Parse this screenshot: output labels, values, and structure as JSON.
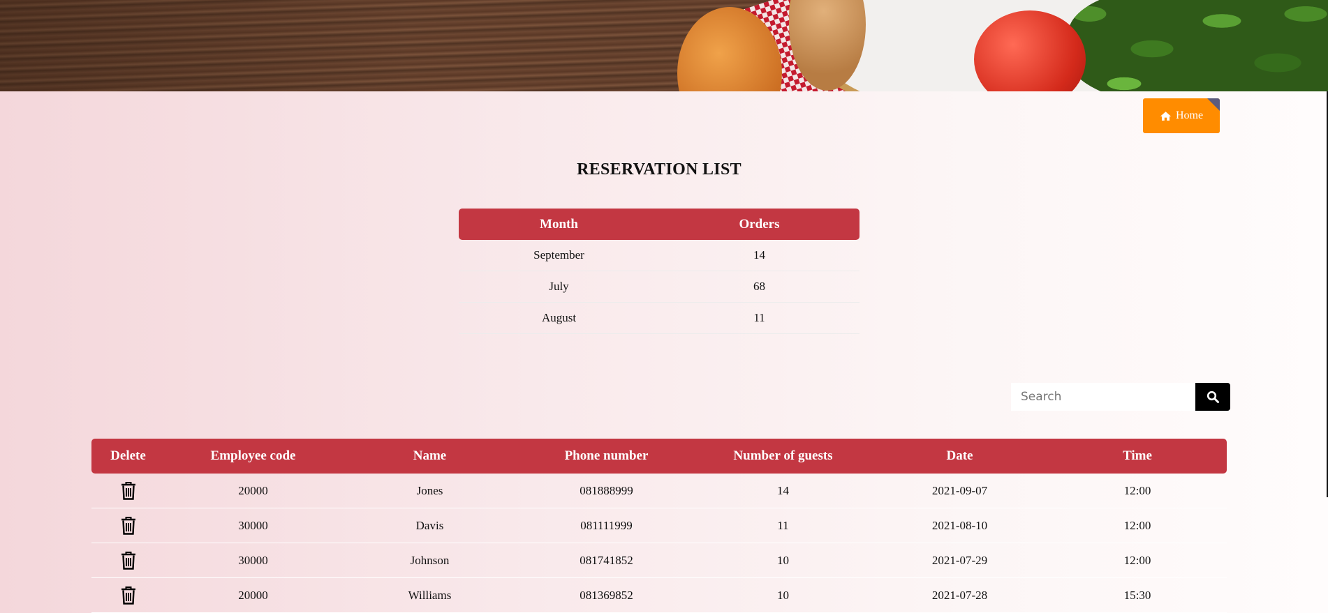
{
  "nav": {
    "home_label": "Home"
  },
  "page": {
    "title": "RESERVATION LIST"
  },
  "summary": {
    "headers": [
      "Month",
      "Orders"
    ],
    "rows": [
      {
        "month": "September",
        "orders": "14"
      },
      {
        "month": "July",
        "orders": "68"
      },
      {
        "month": "August",
        "orders": "11"
      }
    ]
  },
  "search": {
    "placeholder": "Search",
    "value": ""
  },
  "reservations": {
    "headers": [
      "Delete",
      "Employee code",
      "Name",
      "Phone number",
      "Number of guests",
      "Date",
      "Time"
    ],
    "rows": [
      {
        "code": "20000",
        "name": "Jones",
        "phone": "081888999",
        "guests": "14",
        "date": "2021-09-07",
        "time": "12:00"
      },
      {
        "code": "30000",
        "name": "Davis",
        "phone": "081111999",
        "guests": "11",
        "date": "2021-08-10",
        "time": "12:00"
      },
      {
        "code": "30000",
        "name": "Johnson",
        "phone": "081741852",
        "guests": "10",
        "date": "2021-07-29",
        "time": "12:00"
      },
      {
        "code": "20000",
        "name": "Williams",
        "phone": "081369852",
        "guests": "10",
        "date": "2021-07-28",
        "time": "15:30"
      }
    ]
  },
  "colors": {
    "header_red": "#c33742",
    "home_orange": "#ff8c00",
    "search_button": "#000000"
  },
  "icons": {
    "home": "home-icon",
    "search": "search-icon",
    "delete": "trash-icon"
  }
}
